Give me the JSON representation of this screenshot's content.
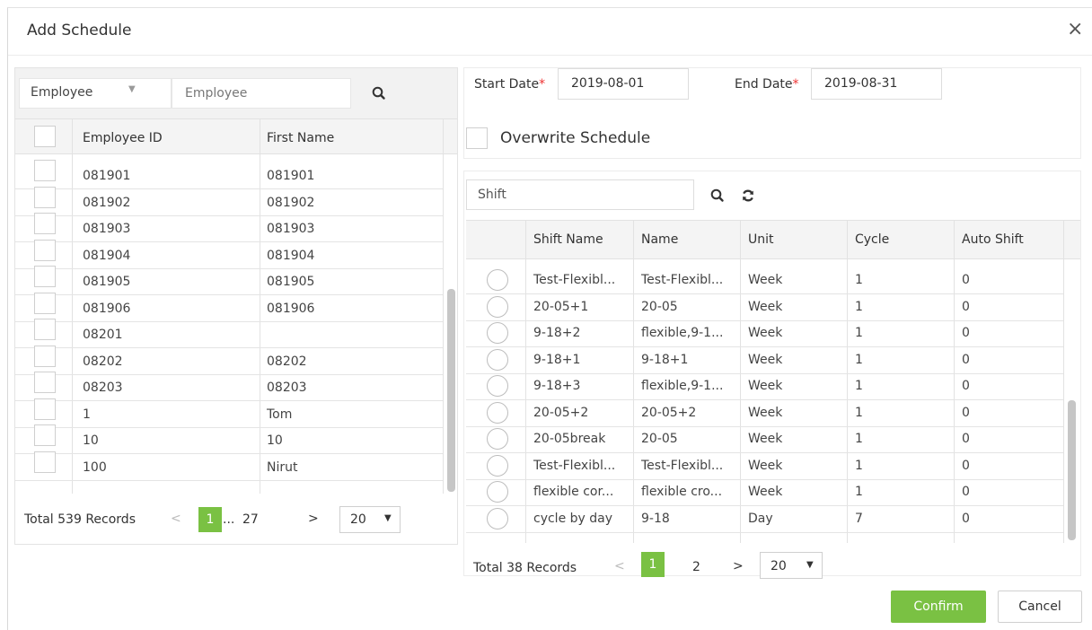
{
  "dialog": {
    "title": "Add Schedule",
    "close_glyph": "×"
  },
  "employee_search": {
    "filter_value": "Employee",
    "placeholder": "Employee",
    "columns": [
      "Employee ID",
      "First Name"
    ],
    "rows": [
      {
        "id": "081901",
        "name": "081901"
      },
      {
        "id": "081902",
        "name": "081902"
      },
      {
        "id": "081903",
        "name": "081903"
      },
      {
        "id": "081904",
        "name": "081904"
      },
      {
        "id": "081905",
        "name": "081905"
      },
      {
        "id": "081906",
        "name": "081906"
      },
      {
        "id": "08201",
        "name": ""
      },
      {
        "id": "08202",
        "name": "08202"
      },
      {
        "id": "08203",
        "name": "08203"
      },
      {
        "id": "1",
        "name": "Tom"
      },
      {
        "id": "10",
        "name": "10"
      },
      {
        "id": "100",
        "name": "Nirut"
      }
    ],
    "pagination": {
      "total": "Total 539 Records",
      "prev": "<",
      "current": "1",
      "ellipsis": "...",
      "last": "27",
      "next": ">",
      "page_size": "20"
    }
  },
  "dates": {
    "start_label": "Start Date",
    "start_value": "2019-08-01",
    "end_label": "End Date",
    "end_value": "2019-08-31",
    "required_mark": "*",
    "overwrite_label": "Overwrite Schedule"
  },
  "shift_search": {
    "placeholder": "Shift",
    "columns": [
      "Shift Name",
      "Name",
      "Unit",
      "Cycle",
      "Auto Shift"
    ],
    "rows": [
      {
        "shift": "Test-Flexibl...",
        "name": "Test-Flexibl...",
        "unit": "Week",
        "cycle": "1",
        "auto": "0"
      },
      {
        "shift": "20-05+1",
        "name": "20-05",
        "unit": "Week",
        "cycle": "1",
        "auto": "0"
      },
      {
        "shift": "9-18+2",
        "name": "flexible,9-1...",
        "unit": "Week",
        "cycle": "1",
        "auto": "0"
      },
      {
        "shift": "9-18+1",
        "name": "9-18+1",
        "unit": "Week",
        "cycle": "1",
        "auto": "0"
      },
      {
        "shift": "9-18+3",
        "name": "flexible,9-1...",
        "unit": "Week",
        "cycle": "1",
        "auto": "0"
      },
      {
        "shift": "20-05+2",
        "name": "20-05+2",
        "unit": "Week",
        "cycle": "1",
        "auto": "0"
      },
      {
        "shift": "20-05break",
        "name": "20-05",
        "unit": "Week",
        "cycle": "1",
        "auto": "0"
      },
      {
        "shift": "Test-Flexibl...",
        "name": "Test-Flexibl...",
        "unit": "Week",
        "cycle": "1",
        "auto": "0"
      },
      {
        "shift": "flexible cor...",
        "name": "flexible cro...",
        "unit": "Week",
        "cycle": "1",
        "auto": "0"
      },
      {
        "shift": "cycle by day",
        "name": "9-18",
        "unit": "Day",
        "cycle": "7",
        "auto": "0"
      }
    ],
    "pagination": {
      "total": "Total 38 Records",
      "prev": "<",
      "current": "1",
      "page2": "2",
      "next": ">",
      "page_size": "20"
    }
  },
  "actions": {
    "confirm": "Confirm",
    "cancel": "Cancel"
  },
  "colors": {
    "accent": "#7ac143",
    "required": "#e33333"
  }
}
